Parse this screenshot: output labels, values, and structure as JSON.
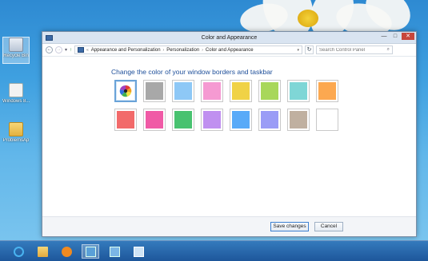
{
  "desktop": {
    "icons": [
      {
        "label": "Recycle Bin",
        "icon": "recycle-bin-icon"
      },
      {
        "label": "Windows 8...",
        "icon": "windows-setup-icon"
      },
      {
        "label": "ProblemsAp",
        "icon": "folder-icon"
      }
    ]
  },
  "window": {
    "title": "Color and Appearance",
    "controls": {
      "minimize": "—",
      "maximize": "□",
      "close": "✕"
    }
  },
  "address": {
    "back": "←",
    "forward": "→",
    "recent": "▾",
    "up": "↑",
    "overflow": "«",
    "breadcrumbs": [
      "Appearance and Personalization",
      "Personalization",
      "Color and Appearance"
    ],
    "separator": "›",
    "dropdown": "▾",
    "refresh": "↻",
    "search_placeholder": "Search Control Panel",
    "search_glyph": "⌕"
  },
  "content": {
    "heading": "Change the color of your window borders and taskbar",
    "swatches": [
      {
        "name": "automatic",
        "color": "#ffffff",
        "selected": true
      },
      {
        "name": "gray",
        "color": "#a8a8a8"
      },
      {
        "name": "light-blue",
        "color": "#8ec8f6"
      },
      {
        "name": "pink",
        "color": "#f59ad2"
      },
      {
        "name": "yellow",
        "color": "#f0d246"
      },
      {
        "name": "lime",
        "color": "#a8d75a"
      },
      {
        "name": "teal",
        "color": "#7fd6d6"
      },
      {
        "name": "orange",
        "color": "#fca850"
      },
      {
        "name": "red",
        "color": "#f26a6a"
      },
      {
        "name": "magenta",
        "color": "#f05aa6"
      },
      {
        "name": "green",
        "color": "#48c270"
      },
      {
        "name": "purple",
        "color": "#c090f0"
      },
      {
        "name": "blue",
        "color": "#58aaf8"
      },
      {
        "name": "periwinkle",
        "color": "#9a9cf6"
      },
      {
        "name": "taupe",
        "color": "#c0b0a0"
      },
      {
        "name": "white",
        "color": "#ffffff"
      }
    ]
  },
  "footer": {
    "save_label": "Save changes",
    "cancel_label": "Cancel"
  },
  "taskbar": {
    "items": [
      {
        "icon": "internet-explorer-icon",
        "active": false
      },
      {
        "icon": "file-explorer-icon",
        "active": false
      },
      {
        "icon": "media-player-icon",
        "active": false
      },
      {
        "icon": "control-panel-icon",
        "active": true
      },
      {
        "icon": "network-icon",
        "active": false
      },
      {
        "icon": "remote-desktop-icon",
        "active": false
      }
    ]
  },
  "colors": {
    "accent": "#1e4f9a",
    "taskbar": "#1e5a9a",
    "close_button": "#c7463b"
  }
}
